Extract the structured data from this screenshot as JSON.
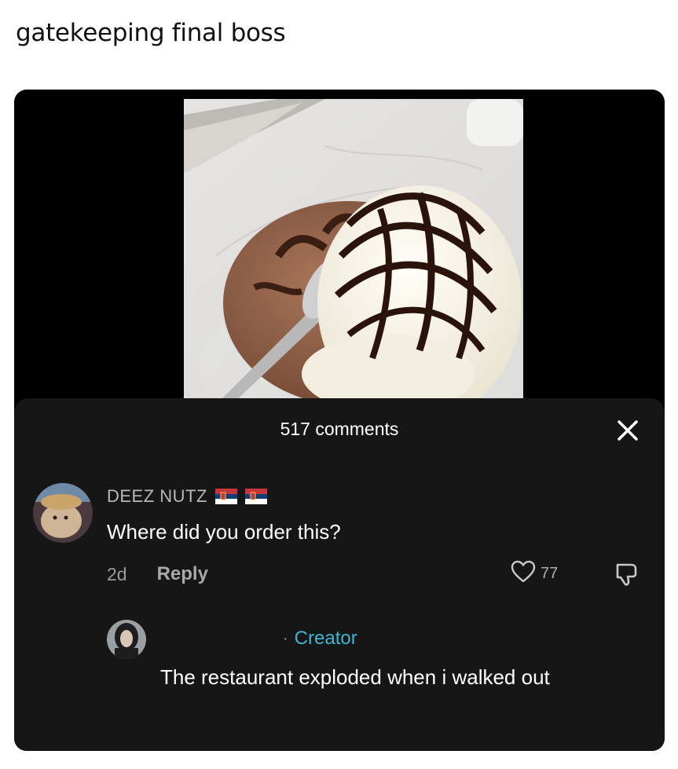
{
  "post": {
    "caption": "gatekeeping final boss"
  },
  "comments_panel": {
    "title": "517 comments",
    "close_icon": "close-icon"
  },
  "comment": {
    "username": "DEEZ NUTZ",
    "flags": [
      "serbia-flag-icon",
      "serbia-flag-icon"
    ],
    "text": "Where did you order this?",
    "timestamp": "2d",
    "reply_label": "Reply",
    "like_count": "77"
  },
  "reply": {
    "separator": "·",
    "badge": "Creator",
    "text": "The restaurant exploded when i walked out"
  },
  "colors": {
    "panel_bg": "#161616",
    "creator_accent": "#3fb6d2",
    "flag_red": "#c6363c",
    "flag_blue": "#0c4076"
  }
}
